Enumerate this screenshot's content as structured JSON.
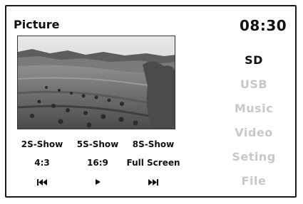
{
  "header": {
    "title": "Picture",
    "time": "08:30"
  },
  "menu": {
    "items": [
      {
        "label": "SD",
        "active": true
      },
      {
        "label": "USB",
        "active": false
      },
      {
        "label": "Music",
        "active": false
      },
      {
        "label": "Video",
        "active": false
      },
      {
        "label": "Seting",
        "active": false
      },
      {
        "label": "File",
        "active": false
      }
    ]
  },
  "slideshow": {
    "options": [
      "2S-Show",
      "5S-Show",
      "8S-Show"
    ]
  },
  "aspect": {
    "options": [
      "4:3",
      "16:9",
      "Full Screen"
    ]
  },
  "playback": {
    "buttons": [
      {
        "icon": "skip-previous-icon"
      },
      {
        "icon": "play-icon"
      },
      {
        "icon": "skip-next-icon"
      }
    ]
  },
  "colors": {
    "active_text": "#111111",
    "inactive_text": "#c8c8c8",
    "frame": "#1a1a1a"
  }
}
